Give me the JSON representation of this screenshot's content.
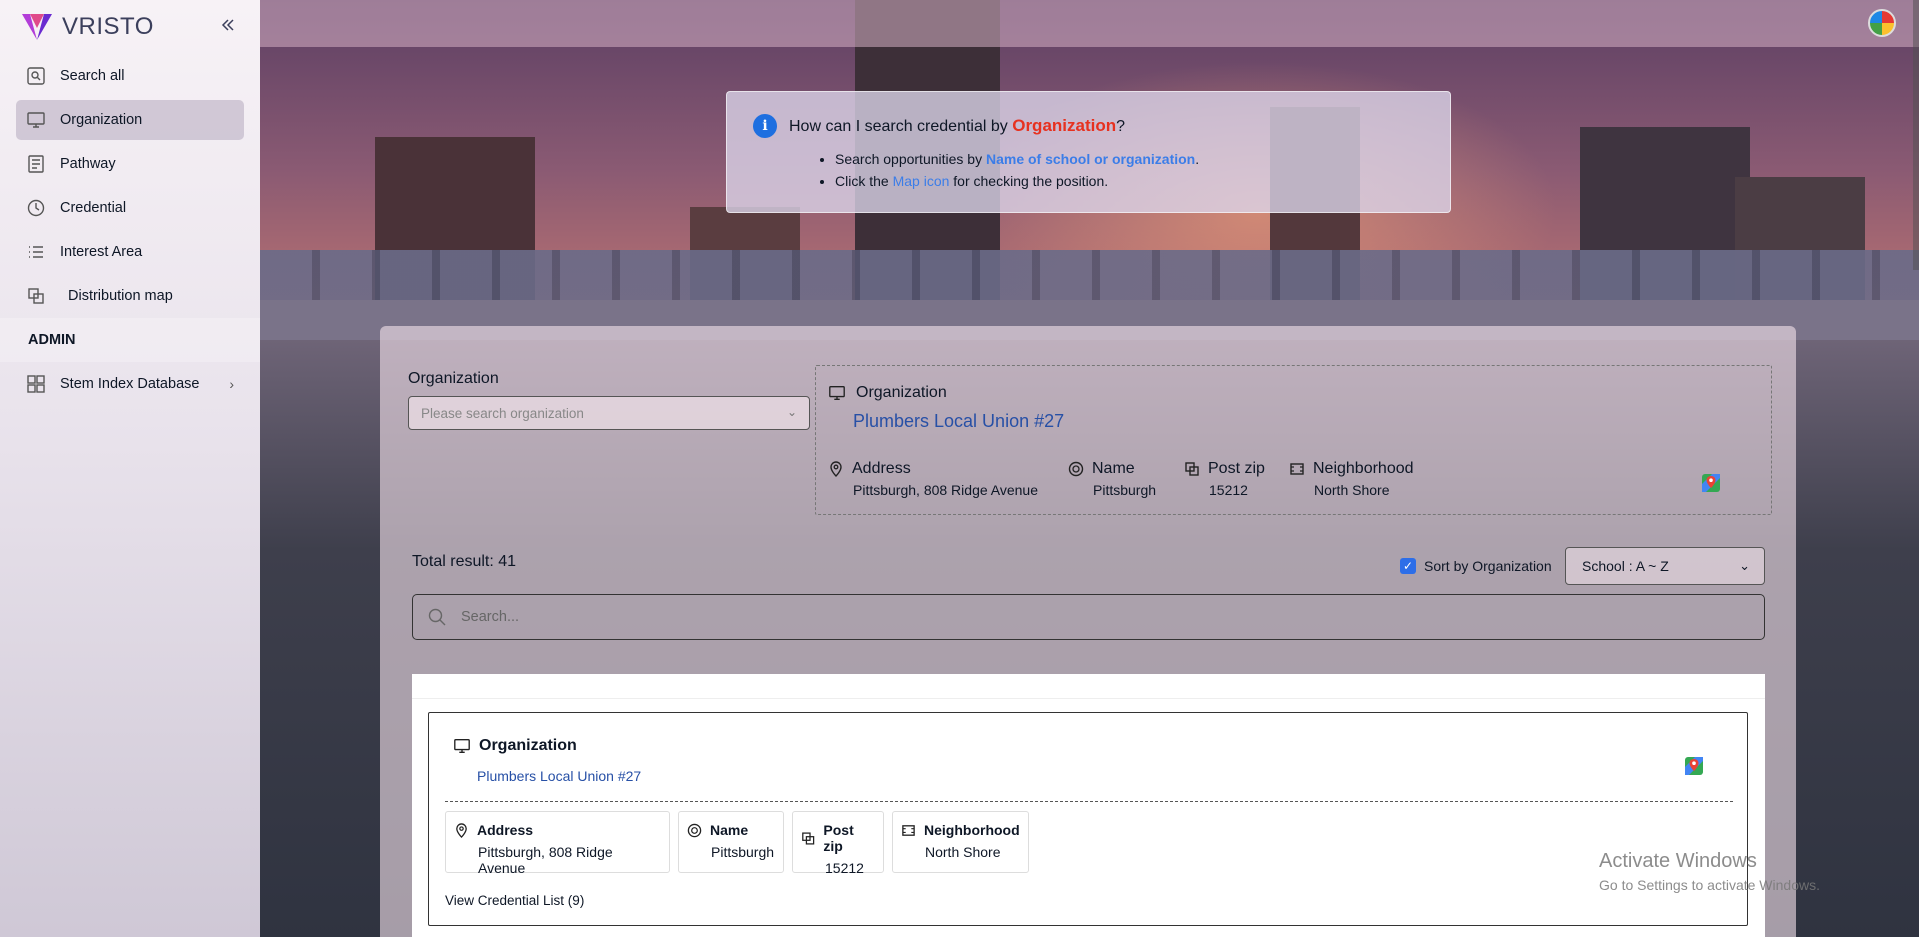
{
  "app": {
    "name": "VRISTO"
  },
  "sidebar": {
    "items": [
      {
        "label": "Search all",
        "icon": "search-all-icon"
      },
      {
        "label": "Organization",
        "icon": "monitor-icon",
        "active": true
      },
      {
        "label": "Pathway",
        "icon": "pathway-icon"
      },
      {
        "label": "Credential",
        "icon": "credential-icon"
      },
      {
        "label": "Interest Area",
        "icon": "list-icon"
      },
      {
        "label": "Distribution map",
        "icon": "map-icon"
      }
    ],
    "section": "ADMIN",
    "admin_items": [
      {
        "label": "Stem Index Database",
        "icon": "grid-icon"
      }
    ]
  },
  "info": {
    "question_prefix": "How can I search credential by ",
    "question_highlight": "Organization",
    "question_suffix": "?",
    "bullet1_prefix": "Search opportunities by ",
    "bullet1_highlight": "Name of school or organization",
    "bullet1_suffix": ".",
    "bullet2_prefix": "Click the ",
    "bullet2_highlight": "Map icon",
    "bullet2_suffix": " for checking the position."
  },
  "filter": {
    "label": "Organization",
    "placeholder": "Please search organization"
  },
  "selected": {
    "title": "Organization",
    "name": "Plumbers Local Union #27",
    "address_label": "Address",
    "address": "Pittsburgh, 808 Ridge Avenue",
    "name_label": "Name",
    "city": "Pittsburgh",
    "zip_label": "Post zip",
    "zip": "15212",
    "neighborhood_label": "Neighborhood",
    "neighborhood": "North Shore"
  },
  "results": {
    "total": "Total result: 41",
    "sort_label": "Sort by Organization",
    "sort_checked": true,
    "sort_value": "School : A ~ Z",
    "search_placeholder": "Search...",
    "cards": [
      {
        "title": "Organization",
        "name": "Plumbers Local Union #27",
        "address_label": "Address",
        "address": "Pittsburgh, 808 Ridge Avenue",
        "name_label": "Name",
        "city": "Pittsburgh",
        "zip_label": "Post zip",
        "zip": "15212",
        "neighborhood_label": "Neighborhood",
        "neighborhood": "North Shore",
        "view_list": "View Credential List (9)"
      }
    ]
  },
  "watermark": {
    "line1": "Activate Windows",
    "line2": "Go to Settings to activate Windows."
  },
  "colors": {
    "accent": "#2d6ee8",
    "org_highlight": "#e7311f",
    "link": "#2750a6",
    "logo": "#8b2fc9"
  }
}
